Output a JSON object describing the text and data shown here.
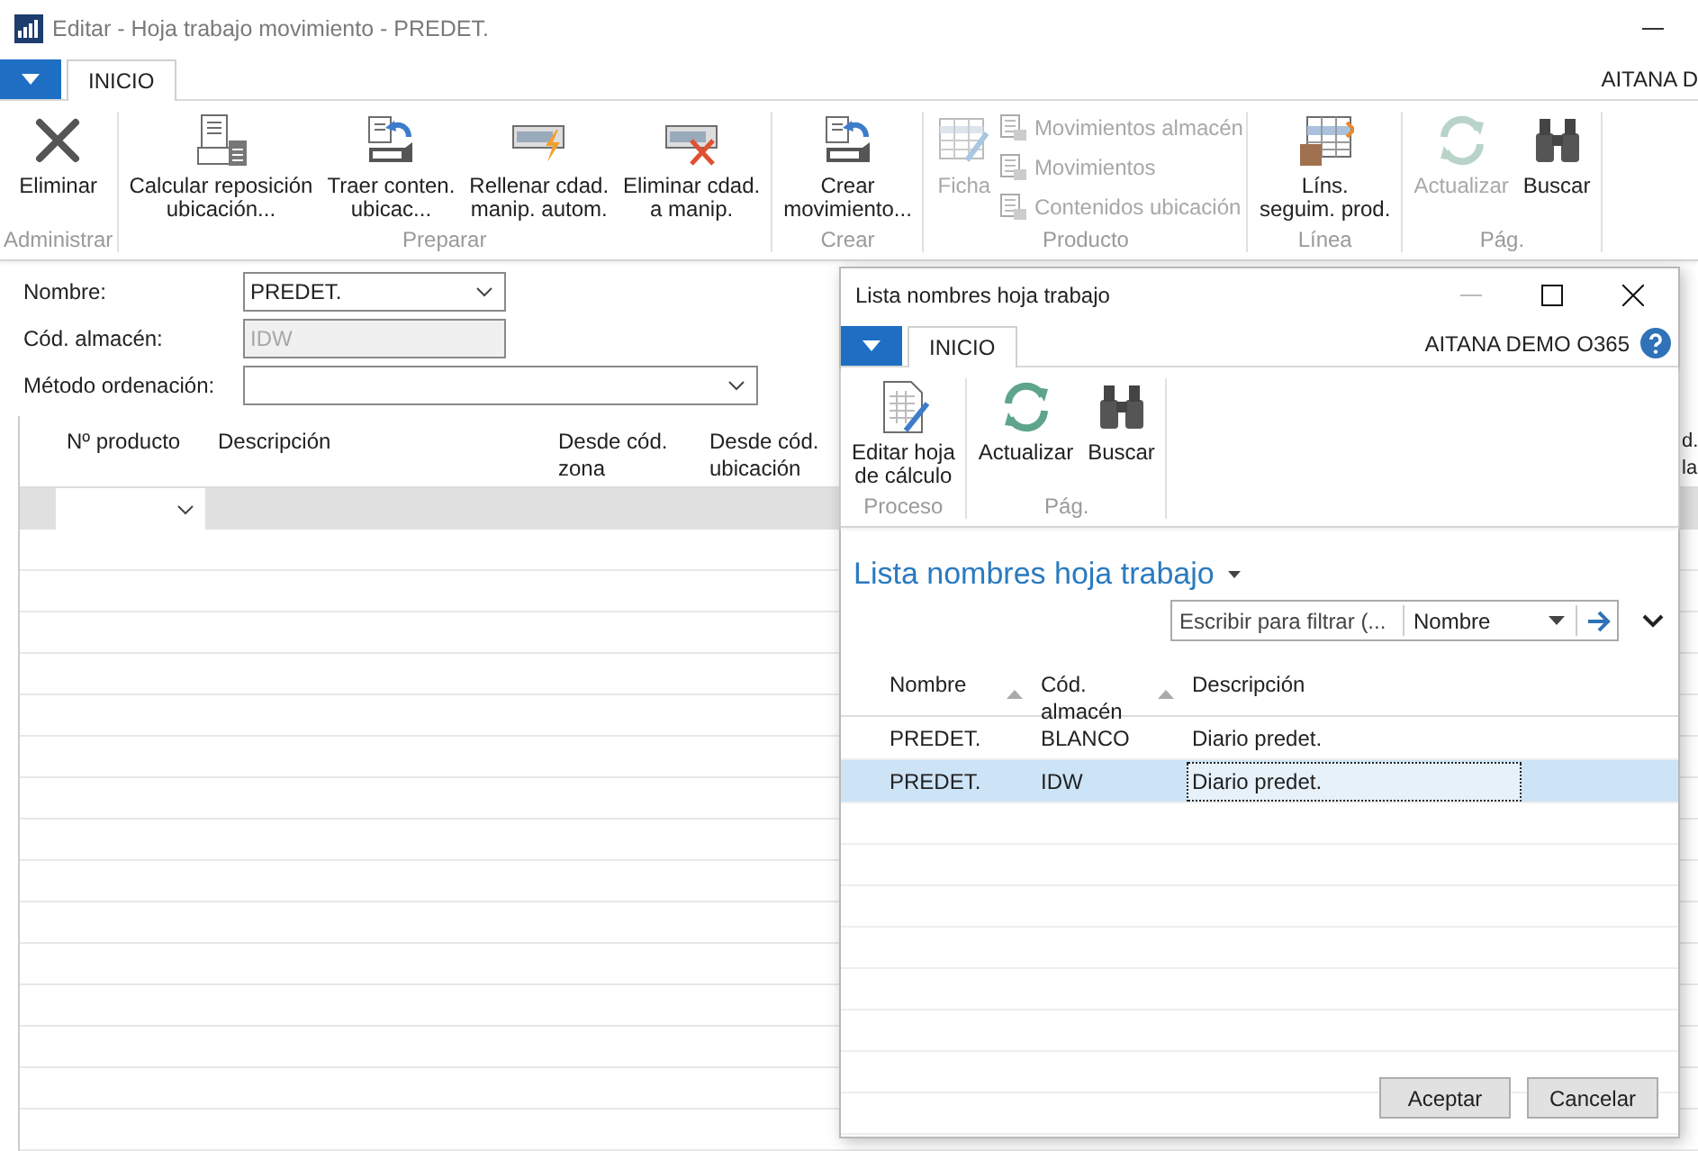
{
  "window": {
    "title": "Editar - Hoja trabajo movimiento - PREDET.",
    "company": "AITANA D"
  },
  "tabs": [
    {
      "label": "INICIO",
      "selected": true
    }
  ],
  "ribbon": [
    {
      "label": "Administrar",
      "actions": [
        {
          "kind": "large",
          "label": "Eliminar",
          "disabled": false
        }
      ]
    },
    {
      "label": "Preparar",
      "actions": [
        {
          "kind": "large",
          "label": "Calcular reposición\nubicación...",
          "disabled": false
        },
        {
          "kind": "large",
          "label": "Traer conten.\nubicac...",
          "disabled": false
        },
        {
          "kind": "large",
          "label": "Rellenar cdad.\nmanip. autom.",
          "disabled": false
        },
        {
          "kind": "large",
          "label": "Eliminar cdad.\na manip.",
          "disabled": false
        }
      ]
    },
    {
      "label": "Crear",
      "actions": [
        {
          "kind": "large",
          "label": "Crear\nmovimiento...",
          "disabled": false
        }
      ]
    },
    {
      "label": "Producto",
      "actions": [
        {
          "kind": "large",
          "label": "Ficha",
          "disabled": true
        },
        {
          "kind": "small",
          "label": "Movimientos almacén",
          "disabled": true
        },
        {
          "kind": "small",
          "label": "Movimientos",
          "disabled": true
        },
        {
          "kind": "small",
          "label": "Contenidos ubicación",
          "disabled": true
        }
      ]
    },
    {
      "label": "Línea",
      "actions": [
        {
          "kind": "large",
          "label": "Líns.\nseguim. prod.",
          "disabled": false
        }
      ]
    },
    {
      "label": "Pág.",
      "actions": [
        {
          "kind": "large",
          "label": "Actualizar",
          "disabled": true
        },
        {
          "kind": "large",
          "label": "Buscar",
          "disabled": false
        }
      ]
    }
  ],
  "fields": [
    {
      "label": "Nombre:",
      "kind": "dropdown",
      "value": "PREDET.",
      "disabled": false
    },
    {
      "label": "Cód. almacén:",
      "kind": "text",
      "value": "IDW",
      "disabled": true
    },
    {
      "label": "Método ordenación:",
      "kind": "dropdown",
      "disabled": false
    }
  ],
  "table": {
    "columns": [
      "Nº producto",
      "Descripción",
      "Desde cód.\nzona",
      "Desde cód.\nubicación",
      "d.\nla"
    ],
    "rows": [
      {
        "selected": true
      }
    ]
  },
  "dialog": {
    "title": "Lista nombres hoja trabajo",
    "company": "AITANA DEMO O365",
    "tabs": [
      {
        "label": "INICIO",
        "selected": true
      }
    ],
    "ribbon": [
      {
        "label": "Proceso",
        "actions": [
          {
            "kind": "large",
            "label": "Editar hoja\nde cálculo",
            "disabled": false
          }
        ]
      },
      {
        "label": "Pág.",
        "actions": [
          {
            "kind": "large",
            "label": "Actualizar",
            "disabled": false
          },
          {
            "kind": "large",
            "label": "Buscar",
            "disabled": false
          }
        ]
      }
    ],
    "list_title": "Lista nombres hoja trabajo",
    "filter": {
      "placeholder": "Escribir para filtrar (...",
      "field": "Nombre"
    },
    "columns": [
      {
        "label": "Nombre",
        "sort_arrow": true
      },
      {
        "label": "Cód.\nalmacén",
        "sort_arrow": true
      },
      {
        "label": "Descripción",
        "sort_arrow": false
      }
    ],
    "rows": [
      {
        "selected": false,
        "cells": [
          {
            "text": "PREDET.",
            "focused": false
          },
          {
            "text": "BLANCO",
            "focused": false
          },
          {
            "text": "Diario predet.",
            "focused": false
          }
        ]
      },
      {
        "selected": true,
        "cells": [
          {
            "text": "PREDET.",
            "focused": false
          },
          {
            "text": "IDW",
            "focused": false
          },
          {
            "text": "Diario predet.",
            "focused": true
          }
        ]
      }
    ],
    "buttons": [
      "Aceptar",
      "Cancelar"
    ]
  }
}
